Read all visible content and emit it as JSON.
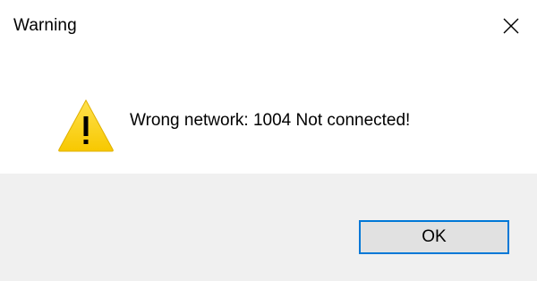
{
  "dialog": {
    "title": "Warning",
    "message": "Wrong network: 1004 Not connected!",
    "icon": "warning-triangle-icon",
    "close_icon": "close-icon",
    "ok_label": "OK",
    "accent_color": "#0078d7",
    "warning_color": "#fcd116"
  }
}
